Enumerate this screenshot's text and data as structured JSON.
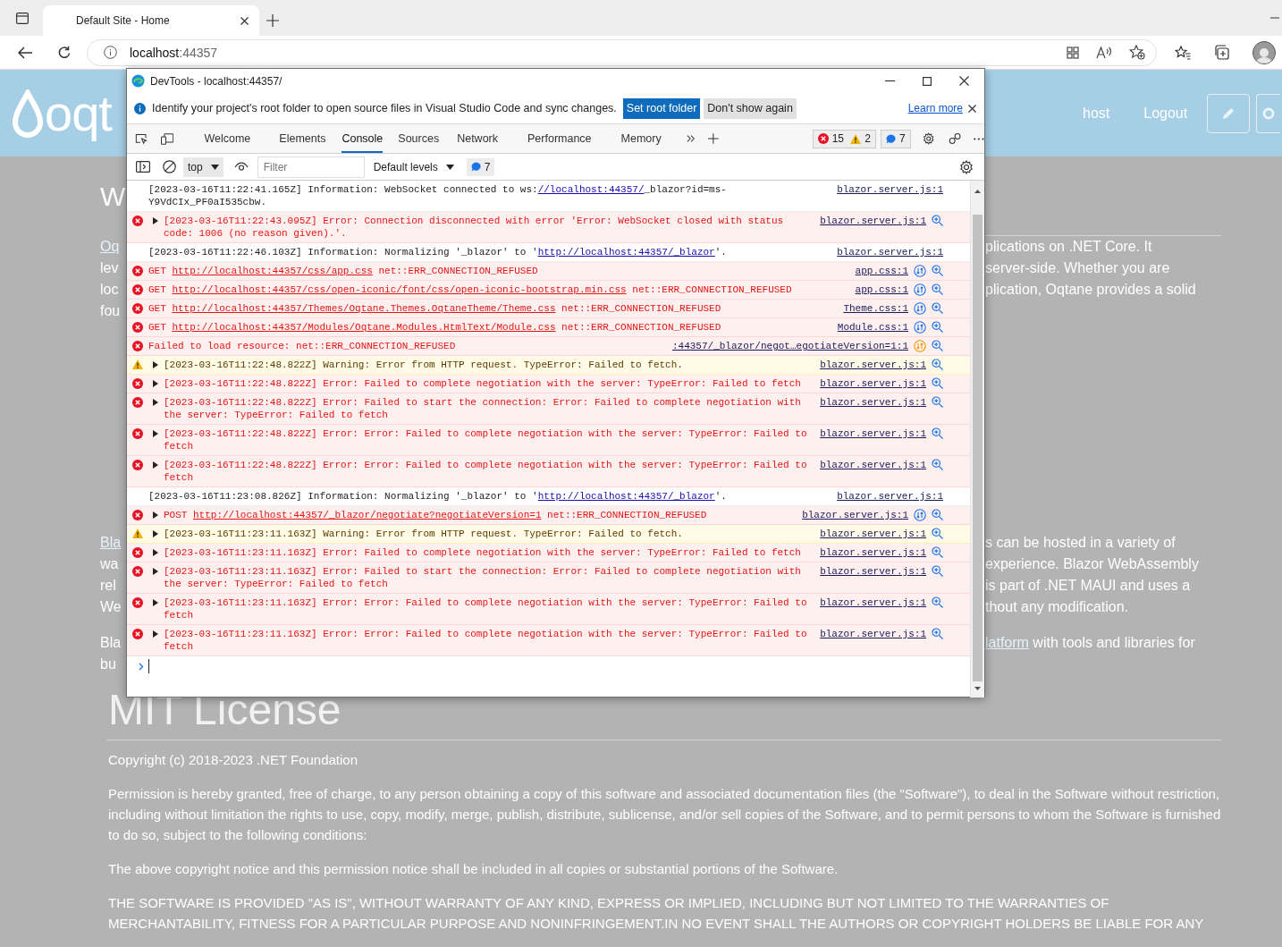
{
  "browser": {
    "tab": {
      "title": "Default Site - Home"
    },
    "address": {
      "host": "localhost",
      "port": ":44357"
    }
  },
  "page": {
    "header": {
      "logo": "oqt",
      "links": [
        {
          "label": "host"
        },
        {
          "label": "Logout"
        }
      ]
    },
    "heading_fragment": "W",
    "blocks": [
      {
        "left": [
          [
            {
              "kind": "link",
              "text": "Oq"
            }
          ],
          [
            {
              "kind": "text",
              "text": "lev"
            }
          ],
          [
            {
              "kind": "text",
              "text": "loc"
            }
          ],
          [
            {
              "kind": "text",
              "text": "fou"
            }
          ]
        ],
        "right": [
          [
            {
              "kind": "text",
              "text": "plications on .NET Core. It"
            }
          ],
          [
            {
              "kind": "text",
              "text": "server-side. Whether you are"
            }
          ],
          [
            {
              "kind": "text",
              "text": "plication, Oqtane provides a solid"
            }
          ]
        ]
      },
      {
        "left": [
          [
            {
              "kind": "link",
              "text": "Bla"
            }
          ],
          [
            {
              "kind": "text",
              "text": "wa"
            }
          ],
          [
            {
              "kind": "text",
              "text": "rel"
            }
          ],
          [
            {
              "kind": "text",
              "text": "We"
            }
          ]
        ],
        "right": [
          [
            {
              "kind": "text",
              "text": "s can be hosted in a variety of"
            }
          ],
          [
            {
              "kind": "text",
              "text": "experience. Blazor WebAssembly"
            }
          ],
          [
            {
              "kind": "text",
              "text": "is part of .NET MAUI and uses a"
            }
          ],
          [
            {
              "kind": "text",
              "text": "thout any modification."
            }
          ]
        ]
      },
      {
        "left": [
          [
            {
              "kind": "text",
              "text": "Bla"
            }
          ],
          [
            {
              "kind": "text",
              "text": "bu"
            }
          ]
        ],
        "right": [
          [
            {
              "kind": "link",
              "text": "latform"
            },
            {
              "kind": "text",
              "text": " with tools and libraries for"
            }
          ]
        ]
      }
    ],
    "license": {
      "title": "MIT License",
      "paragraphs": [
        "Copyright (c) 2018-2023 .NET Foundation",
        "Permission is hereby granted, free of charge, to any person obtaining a copy of this software and associated documentation files (the \"Software\"), to deal in the Software without restriction, including without limitation the rights to use, copy, modify, merge, publish, distribute, sublicense, and/or sell copies of the Software, and to permit persons to whom the Software is furnished to do so, subject to the following conditions:",
        "The above copyright notice and this permission notice shall be included in all copies or substantial portions of the Software.",
        "THE SOFTWARE IS PROVIDED \"AS IS\", WITHOUT WARRANTY OF ANY KIND, EXPRESS OR IMPLIED, INCLUDING BUT NOT LIMITED TO THE WARRANTIES OF MERCHANTABILITY, FITNESS FOR A PARTICULAR PURPOSE AND NONINFRINGEMENT.IN NO EVENT SHALL THE AUTHORS OR COPYRIGHT HOLDERS BE LIABLE FOR ANY"
      ]
    }
  },
  "devtools": {
    "title": "DevTools - localhost:44357/",
    "infobar": {
      "message": "Identify your project's root folder to open source files in Visual Studio Code and sync changes.",
      "primary_button": "Set root folder",
      "secondary_button": "Don't show again",
      "link": "Learn more"
    },
    "tabs": [
      {
        "label": "Welcome",
        "selected": false
      },
      {
        "label": "Elements",
        "selected": false
      },
      {
        "label": "Console",
        "selected": true
      },
      {
        "label": "Sources",
        "selected": false
      },
      {
        "label": "Network",
        "selected": false
      },
      {
        "label": "Performance",
        "selected": false
      },
      {
        "label": "Memory",
        "selected": false
      }
    ],
    "counts": {
      "errors": "15",
      "warnings": "2",
      "info": "7"
    },
    "console_toolbar": {
      "context": "top",
      "filter_placeholder": "Filter",
      "levels": "Default levels",
      "info_count": "7"
    },
    "messages": [
      {
        "kind": "info",
        "expandable": false,
        "segments": [
          {
            "kind": "text",
            "text": "[2023-03-16T11:22:41.165Z] Information: WebSocket connected to ws:"
          },
          {
            "kind": "link",
            "text": "//localhost:44357/"
          },
          {
            "kind": "text",
            "text": "_blazor?id=ms-Y9VdCIx_PF0aI535cbw."
          }
        ],
        "source": "blazor.server.js:1",
        "network_icon": false,
        "network_warning": false,
        "search": false
      },
      {
        "kind": "error",
        "expandable": true,
        "segments": [
          {
            "kind": "text",
            "text": "[2023-03-16T11:22:43.095Z] Error: Connection disconnected with error 'Error: WebSocket closed with status code: 1006 (no reason given).'."
          }
        ],
        "source": "blazor.server.js:1",
        "network_icon": false,
        "network_warning": false,
        "search": true
      },
      {
        "kind": "info",
        "expandable": false,
        "segments": [
          {
            "kind": "text",
            "text": "[2023-03-16T11:22:46.103Z] Information: Normalizing '_blazor' to '"
          },
          {
            "kind": "link",
            "text": "http://localhost:44357/_blazor"
          },
          {
            "kind": "text",
            "text": "'."
          }
        ],
        "source": "blazor.server.js:1",
        "network_icon": false,
        "network_warning": false,
        "search": false
      },
      {
        "kind": "error",
        "expandable": false,
        "segments": [
          {
            "kind": "text",
            "text": "GET "
          },
          {
            "kind": "link",
            "text": "http://localhost:44357/css/app.css"
          },
          {
            "kind": "text",
            "text": " net::ERR_CONNECTION_REFUSED"
          }
        ],
        "source": "app.css:1",
        "network_icon": true,
        "network_warning": false,
        "search": true
      },
      {
        "kind": "error",
        "expandable": false,
        "segments": [
          {
            "kind": "text",
            "text": "GET "
          },
          {
            "kind": "link",
            "text": "http://localhost:44357/css/open-iconic/font/css/open-iconic-bootstrap.min.css"
          },
          {
            "kind": "text",
            "text": " net::ERR_CONNECTION_REFUSED"
          }
        ],
        "source": "app.css:1",
        "network_icon": true,
        "network_warning": false,
        "search": true
      },
      {
        "kind": "error",
        "expandable": false,
        "segments": [
          {
            "kind": "text",
            "text": "GET "
          },
          {
            "kind": "link",
            "text": "http://localhost:44357/Themes/Oqtane.Themes.OqtaneTheme/Theme.css"
          },
          {
            "kind": "text",
            "text": " net::ERR_CONNECTION_REFUSED"
          }
        ],
        "source": "Theme.css:1",
        "network_icon": true,
        "network_warning": false,
        "search": true
      },
      {
        "kind": "error",
        "expandable": false,
        "segments": [
          {
            "kind": "text",
            "text": "GET "
          },
          {
            "kind": "link",
            "text": "http://localhost:44357/Modules/Oqtane.Modules.HtmlText/Module.css"
          },
          {
            "kind": "text",
            "text": " net::ERR_CONNECTION_REFUSED"
          }
        ],
        "source": "Module.css:1",
        "network_icon": true,
        "network_warning": false,
        "search": true
      },
      {
        "kind": "error",
        "expandable": false,
        "segments": [
          {
            "kind": "text",
            "text": "Failed to load resource: net::ERR_CONNECTION_REFUSED"
          }
        ],
        "source": ":44357/_blazor/negot…egotiateVersion=1:1",
        "network_icon": true,
        "network_warning": true,
        "search": true
      },
      {
        "kind": "warning",
        "expandable": true,
        "segments": [
          {
            "kind": "text",
            "text": "[2023-03-16T11:22:48.822Z] Warning: Error from HTTP request. TypeError: Failed to fetch."
          }
        ],
        "source": "blazor.server.js:1",
        "network_icon": false,
        "network_warning": false,
        "search": true
      },
      {
        "kind": "error",
        "expandable": true,
        "segments": [
          {
            "kind": "text",
            "text": "[2023-03-16T11:22:48.822Z] Error: Failed to complete negotiation with the server: TypeError: Failed to fetch"
          }
        ],
        "source": "blazor.server.js:1",
        "network_icon": false,
        "network_warning": false,
        "search": true
      },
      {
        "kind": "error",
        "expandable": true,
        "segments": [
          {
            "kind": "text",
            "text": "[2023-03-16T11:22:48.822Z] Error: Failed to start the connection: Error: Failed to complete negotiation with the server: TypeError: Failed to fetch"
          }
        ],
        "source": "blazor.server.js:1",
        "network_icon": false,
        "network_warning": false,
        "search": true
      },
      {
        "kind": "error",
        "expandable": true,
        "segments": [
          {
            "kind": "text",
            "text": "[2023-03-16T11:22:48.822Z] Error: Error: Failed to complete negotiation with the server: TypeError: Failed to fetch"
          }
        ],
        "source": "blazor.server.js:1",
        "network_icon": false,
        "network_warning": false,
        "search": true
      },
      {
        "kind": "error",
        "expandable": true,
        "segments": [
          {
            "kind": "text",
            "text": "[2023-03-16T11:22:48.822Z] Error: Error: Failed to complete negotiation with the server: TypeError: Failed to fetch"
          }
        ],
        "source": "blazor.server.js:1",
        "network_icon": false,
        "network_warning": false,
        "search": true
      },
      {
        "kind": "info",
        "expandable": false,
        "segments": [
          {
            "kind": "text",
            "text": "[2023-03-16T11:23:08.826Z] Information: Normalizing '_blazor' to '"
          },
          {
            "kind": "link",
            "text": "http://localhost:44357/_blazor"
          },
          {
            "kind": "text",
            "text": "'."
          }
        ],
        "source": "blazor.server.js:1",
        "network_icon": false,
        "network_warning": false,
        "search": false
      },
      {
        "kind": "error",
        "expandable": true,
        "segments": [
          {
            "kind": "text",
            "text": "POST "
          },
          {
            "kind": "link",
            "text": "http://localhost:44357/_blazor/negotiate?negotiateVersion=1"
          },
          {
            "kind": "text",
            "text": " net::ERR_CONNECTION_REFUSED"
          }
        ],
        "source": "blazor.server.js:1",
        "network_icon": true,
        "network_warning": false,
        "search": true
      },
      {
        "kind": "warning",
        "expandable": true,
        "segments": [
          {
            "kind": "text",
            "text": "[2023-03-16T11:23:11.163Z] Warning: Error from HTTP request. TypeError: Failed to fetch."
          }
        ],
        "source": "blazor.server.js:1",
        "network_icon": false,
        "network_warning": false,
        "search": true
      },
      {
        "kind": "error",
        "expandable": true,
        "segments": [
          {
            "kind": "text",
            "text": "[2023-03-16T11:23:11.163Z] Error: Failed to complete negotiation with the server: TypeError: Failed to fetch"
          }
        ],
        "source": "blazor.server.js:1",
        "network_icon": false,
        "network_warning": false,
        "search": true
      },
      {
        "kind": "error",
        "expandable": true,
        "segments": [
          {
            "kind": "text",
            "text": "[2023-03-16T11:23:11.163Z] Error: Failed to start the connection: Error: Failed to complete negotiation with the server: TypeError: Failed to fetch"
          }
        ],
        "source": "blazor.server.js:1",
        "network_icon": false,
        "network_warning": false,
        "search": true
      },
      {
        "kind": "error",
        "expandable": true,
        "segments": [
          {
            "kind": "text",
            "text": "[2023-03-16T11:23:11.163Z] Error: Error: Failed to complete negotiation with the server: TypeError: Failed to fetch"
          }
        ],
        "source": "blazor.server.js:1",
        "network_icon": false,
        "network_warning": false,
        "search": true
      },
      {
        "kind": "error",
        "expandable": true,
        "segments": [
          {
            "kind": "text",
            "text": "[2023-03-16T11:23:11.163Z] Error: Error: Failed to complete negotiation with the server: TypeError: Failed to fetch"
          }
        ],
        "source": "blazor.server.js:1",
        "network_icon": false,
        "network_warning": false,
        "search": true
      }
    ]
  }
}
